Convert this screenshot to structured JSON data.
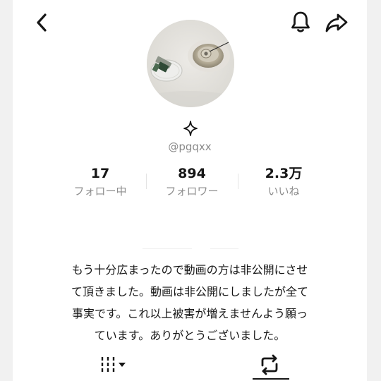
{
  "header": {
    "back_icon": "chevron-left-icon",
    "notification_icon": "bell-icon",
    "share_icon": "share-arrow-icon"
  },
  "profile": {
    "avatar": "profile-photo",
    "badge_icon": "sparkle-icon",
    "username": "@pgqxx"
  },
  "stats": {
    "following": {
      "value": "17",
      "label": "フォロー中"
    },
    "followers": {
      "value": "894",
      "label": "フォロワー"
    },
    "likes": {
      "value": "2.3万",
      "label": "いいね"
    }
  },
  "bio": {
    "lines": [
      "もう十分広まったので動画の方は非公開にさせ",
      "て頂きました。動画は非公開にしましたが全て",
      "事実です。これ以上被害が増えませんよう願っ",
      "ています。ありがとうございました。"
    ]
  },
  "tabs": [
    {
      "icon": "grid-dropdown-icon",
      "active": false
    },
    {
      "icon": "repost-icon",
      "active": true
    }
  ]
}
